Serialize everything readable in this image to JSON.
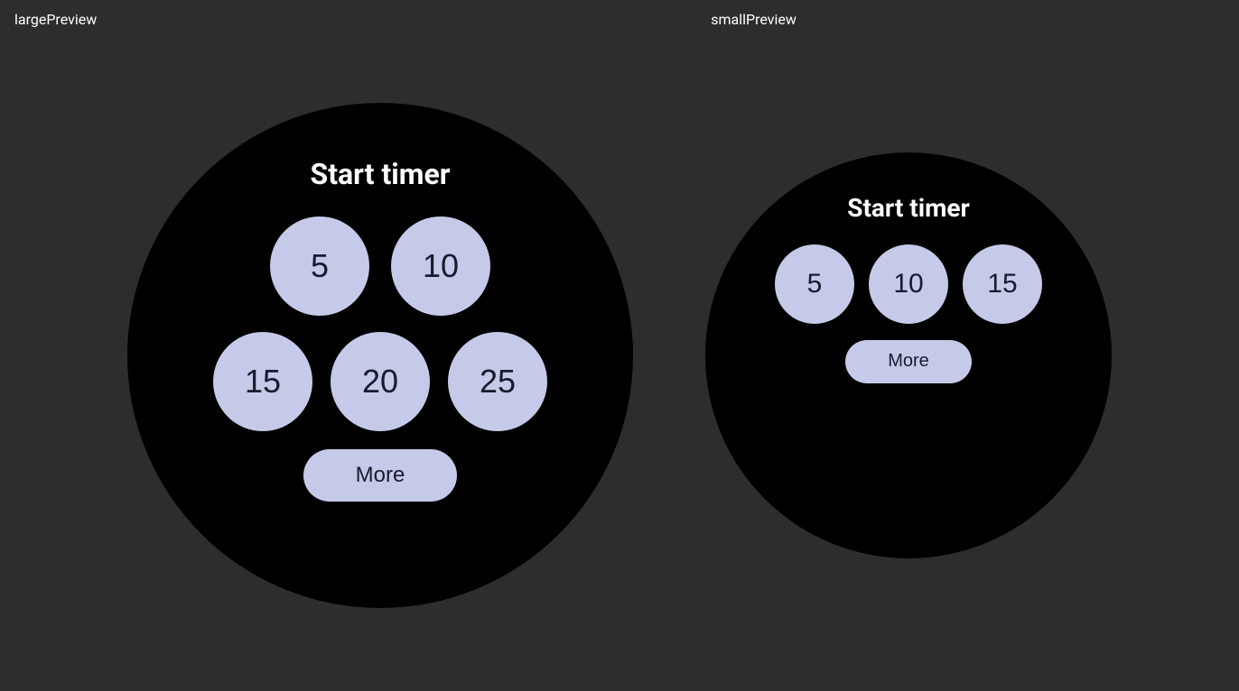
{
  "large_preview": {
    "label": "largePreview",
    "title": "Start timer",
    "row1_buttons": [
      {
        "value": "5"
      },
      {
        "value": "10"
      }
    ],
    "row2_buttons": [
      {
        "value": "15"
      },
      {
        "value": "20"
      },
      {
        "value": "25"
      }
    ],
    "more_button": "More"
  },
  "small_preview": {
    "label": "smallPreview",
    "title": "Start timer",
    "row1_buttons": [
      {
        "value": "5"
      },
      {
        "value": "10"
      },
      {
        "value": "15"
      }
    ],
    "more_button": "More"
  },
  "colors": {
    "background": "#2d2d2d",
    "watch_face": "#000000",
    "button_bg": "#c5cae9",
    "button_text": "#1a1a2e",
    "title_text": "#ffffff",
    "label_text": "#ffffff"
  }
}
